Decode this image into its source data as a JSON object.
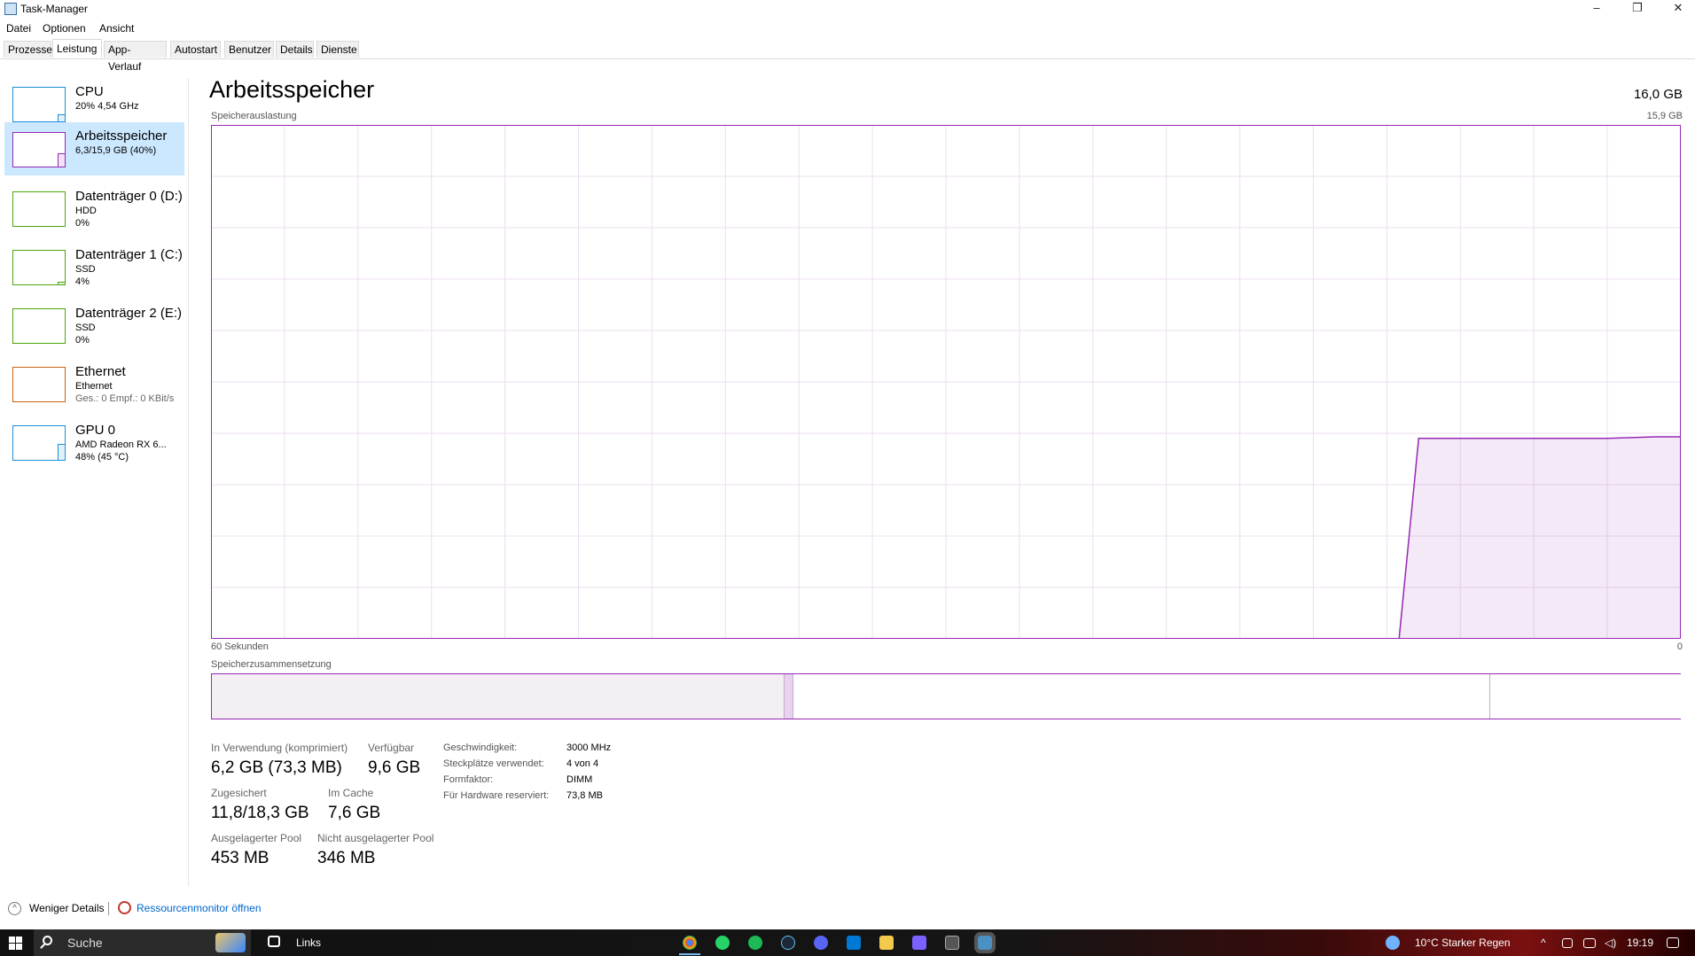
{
  "window": {
    "title": "Task-Manager",
    "minimize": "–",
    "restore": "❐",
    "close": "✕"
  },
  "menu": [
    "Datei",
    "Optionen",
    "Ansicht"
  ],
  "tabs": [
    "Prozesse",
    "Leistung",
    "App-Verlauf",
    "Autostart",
    "Benutzer",
    "Details",
    "Dienste"
  ],
  "active_tab": "Leistung",
  "sidebar": {
    "items": [
      {
        "name": "CPU",
        "sub1": "20% 4,54 GHz",
        "sub2": "",
        "color": "#1b8fd6",
        "level": 0.2
      },
      {
        "name": "Arbeitsspeicher",
        "sub1": "6,3/15,9 GB (40%)",
        "sub2": "",
        "color": "#9528b4",
        "level": 0.4
      },
      {
        "name": "Datenträger 0 (D:)",
        "sub1": "HDD",
        "sub2": "0%",
        "color": "#4da60c",
        "level": 0
      },
      {
        "name": "Datenträger 1 (C:)",
        "sub1": "SSD",
        "sub2": "4%",
        "color": "#4da60c",
        "level": 0.04
      },
      {
        "name": "Datenträger 2 (E:)",
        "sub1": "SSD",
        "sub2": "0%",
        "color": "#4da60c",
        "level": 0
      },
      {
        "name": "Ethernet",
        "sub1": "Ethernet",
        "sub2": "Ges.: 0 Empf.: 0 KBit/s",
        "color": "#c8630f",
        "level": 0
      },
      {
        "name": "GPU 0",
        "sub1": "AMD Radeon RX 6...",
        "sub2": "48% (45 °C)",
        "color": "#1b8fd6",
        "level": 0.48
      }
    ]
  },
  "main": {
    "title": "Arbeitsspeicher",
    "total": "16,0 GB",
    "usage_label": "Speicherauslastung",
    "usage_max": "15,9 GB",
    "time_left": "60 Sekunden",
    "time_right": "0",
    "composition_label": "Speicherzusammensetzung"
  },
  "chart_data": {
    "type": "area",
    "title": "Speicherauslastung",
    "xlabel": "",
    "ylabel": "",
    "xlim": [
      60,
      0
    ],
    "ylim": [
      0,
      15.9
    ],
    "grid": true,
    "x": [
      60,
      11.5,
      10.7,
      3,
      1,
      0
    ],
    "values": [
      0,
      0,
      6.2,
      6.2,
      6.25,
      6.25
    ],
    "color": "#9528b4"
  },
  "composition": {
    "in_use_fraction": 0.39,
    "modified_fraction": 0.006,
    "standby_fraction": 0.475,
    "free_fraction": 0.13
  },
  "stats": {
    "in_use_label": "In Verwendung (komprimiert)",
    "in_use_value": "6,2 GB (73,3 MB)",
    "available_label": "Verfügbar",
    "available_value": "9,6 GB",
    "committed_label": "Zugesichert",
    "committed_value": "11,8/18,3 GB",
    "cached_label": "Im Cache",
    "cached_value": "7,6 GB",
    "paged_label": "Ausgelagerter Pool",
    "paged_value": "453 MB",
    "nonpaged_label": "Nicht ausgelagerter Pool",
    "nonpaged_value": "346 MB"
  },
  "specs": [
    {
      "key": "Geschwindigkeit:",
      "value": "3000 MHz"
    },
    {
      "key": "Steckplätze verwendet:",
      "value": "4 von 4"
    },
    {
      "key": "Formfaktor:",
      "value": "DIMM"
    },
    {
      "key": "Für Hardware reserviert:",
      "value": "73,8 MB"
    }
  ],
  "footer": {
    "less_details": "Weniger Details",
    "resource_monitor": "Ressourcenmonitor öffnen"
  },
  "taskbar": {
    "search_placeholder": "Suche",
    "links": "Links",
    "weather": "10°C  Starker Regen",
    "time": "19:19"
  }
}
